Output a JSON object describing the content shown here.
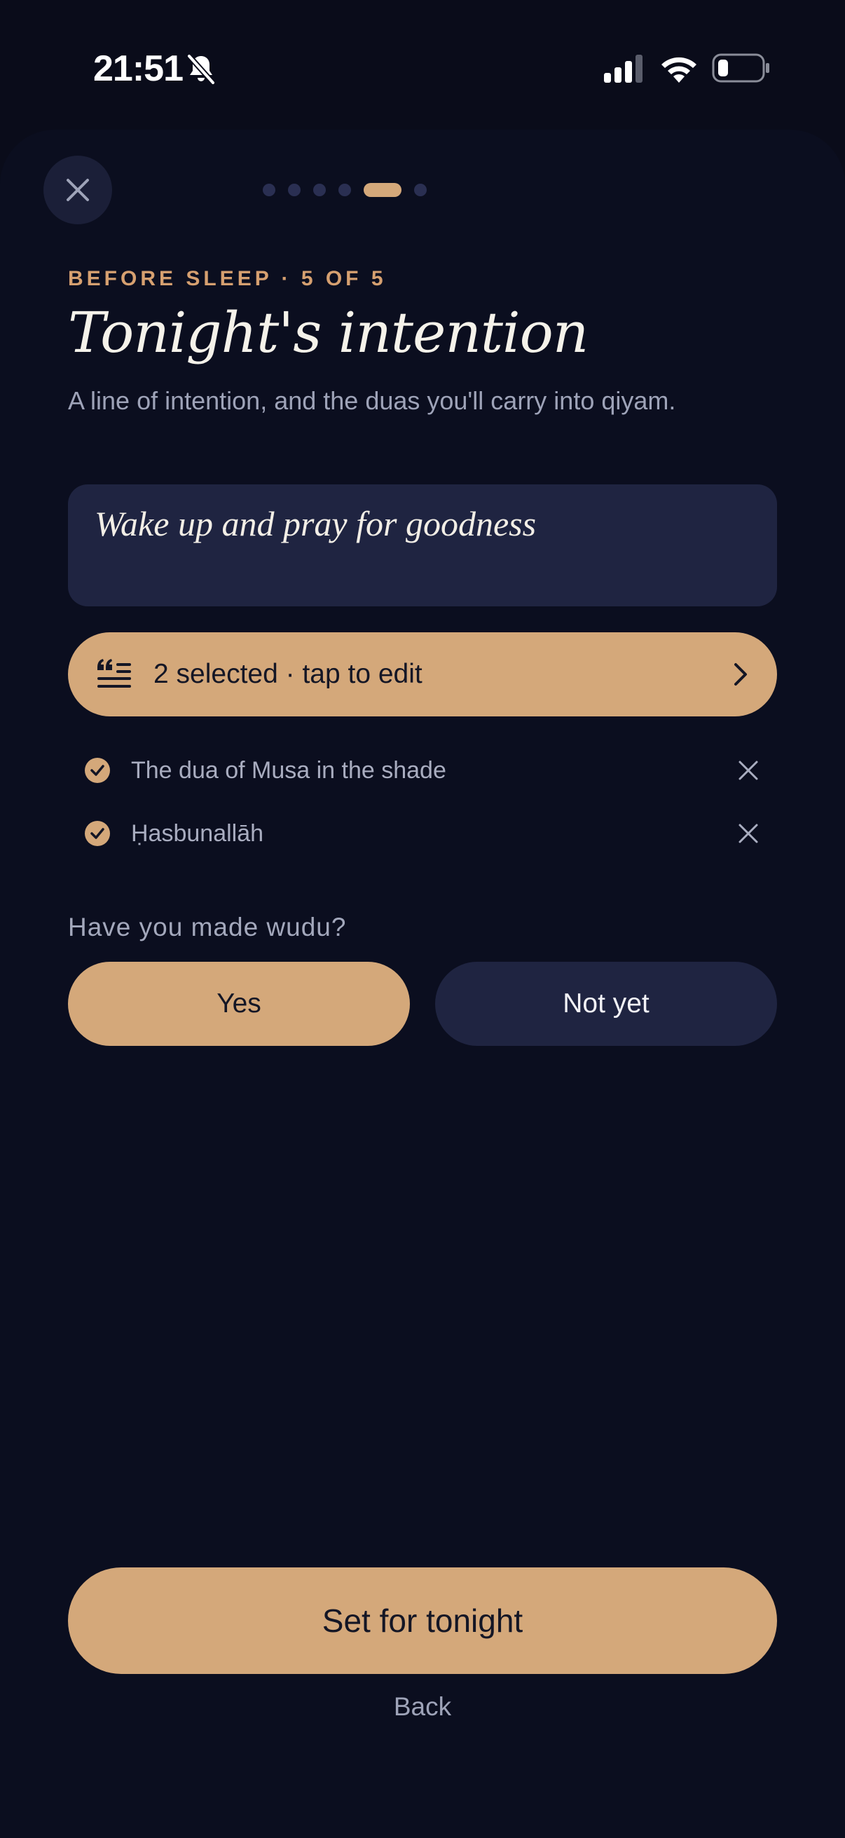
{
  "status_bar": {
    "time": "21:51"
  },
  "header": {
    "eyebrow": "BEFORE SLEEP · 5 OF 5",
    "title": "Tonight's intention",
    "subtitle": "A line of intention, and the duas you'll carry into qiyam.",
    "progress": {
      "current_step": 5,
      "total_steps": 6
    }
  },
  "intention": {
    "value": "Wake up and pray for goodness"
  },
  "duas": {
    "button_label": "2 selected · tap to edit",
    "selected": [
      {
        "label": "The dua of Musa in the shade"
      },
      {
        "label": "Ḥasbunallāh"
      }
    ]
  },
  "wudu": {
    "question": "Have you made wudu?",
    "yes_label": "Yes",
    "no_label": "Not yet",
    "selected": "Yes"
  },
  "actions": {
    "primary_label": "Set for tonight",
    "back_label": "Back"
  },
  "colors": {
    "background": "#0b0e1f",
    "accent": "#d4a87a",
    "card": "#1f2441",
    "eyebrow": "#d6a070"
  },
  "icons": [
    "close-icon",
    "bell-slash-icon",
    "signal-icon",
    "wifi-icon",
    "battery-icon",
    "quote-list-icon",
    "chevron-right-icon",
    "check-circle-icon",
    "remove-x-icon"
  ]
}
